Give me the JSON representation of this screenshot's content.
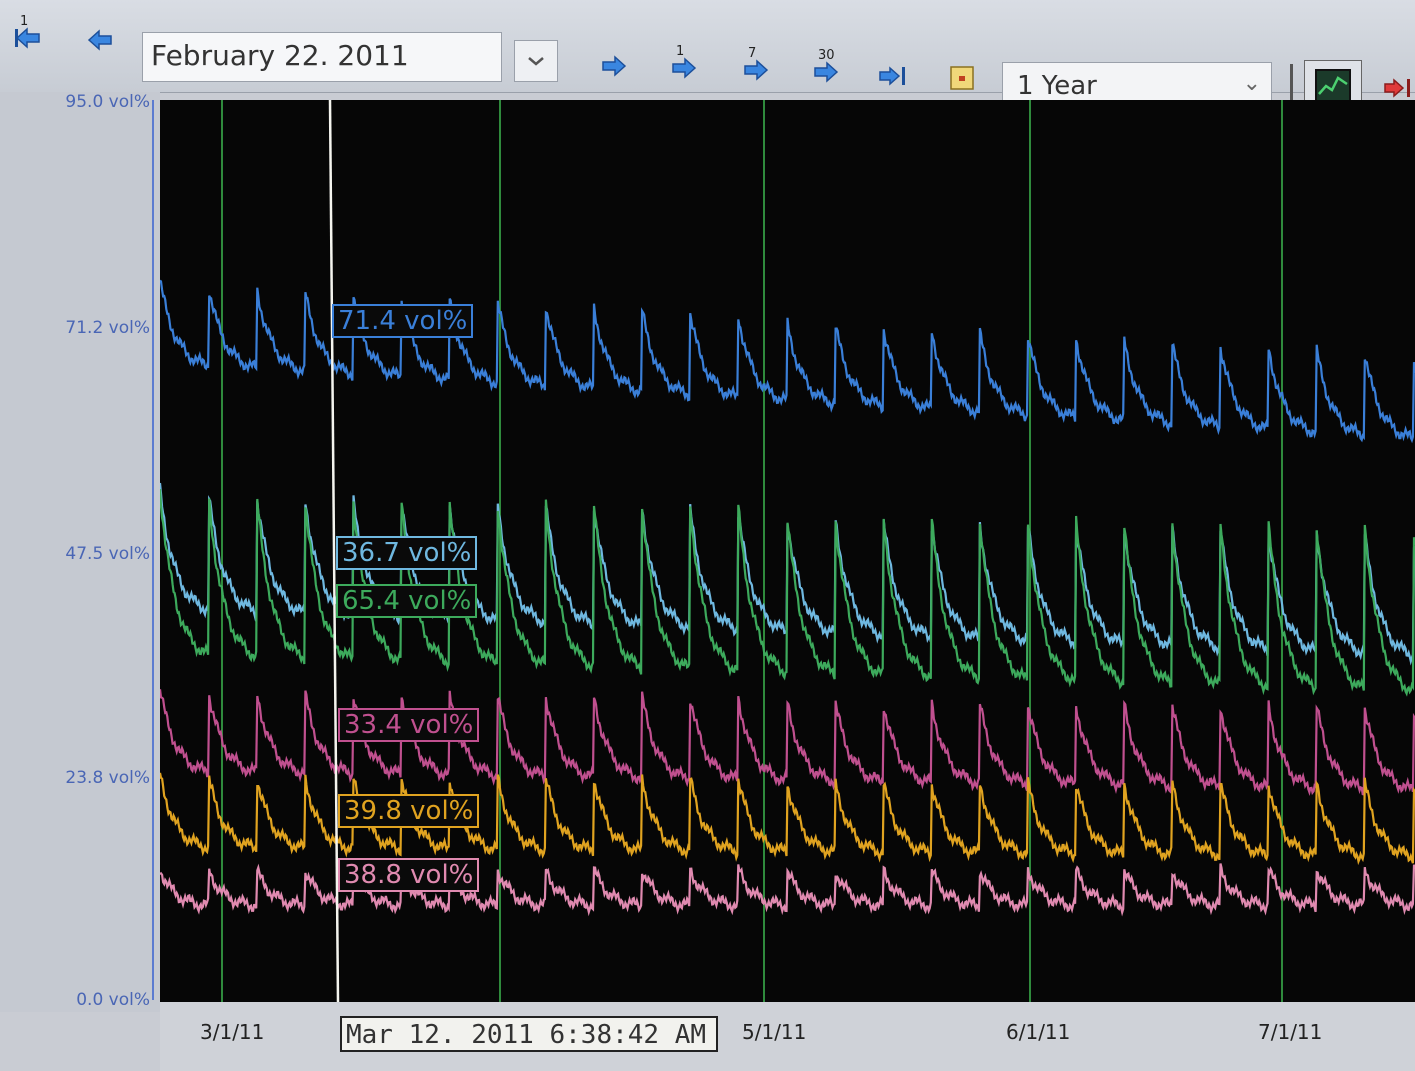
{
  "toolbar": {
    "date_value": "February 22. 2011",
    "step_labels": [
      "1",
      "1",
      "7",
      "30"
    ],
    "range_value": "1 Year"
  },
  "y_axis": {
    "ticks": [
      "95.0 vol%",
      "71.2 vol%",
      "47.5 vol%",
      "23.8 vol%",
      "0.0 vol%"
    ]
  },
  "x_axis": {
    "ticks": [
      "3/1/11",
      "5/1/11",
      "6/1/11",
      "7/1/11"
    ]
  },
  "cursor": {
    "time_label": "Mar 12. 2011 6:38:42 AM"
  },
  "series_labels": [
    {
      "text": "71.4 vol%",
      "color": "#3a7fd8"
    },
    {
      "text": "36.7 vol%",
      "color": "#6fb8e0"
    },
    {
      "text": "65.4 vol%",
      "color": "#3daa5c"
    },
    {
      "text": "33.4 vol%",
      "color": "#c0508f"
    },
    {
      "text": "39.8 vol%",
      "color": "#e0a320"
    },
    {
      "text": "38.8 vol%",
      "color": "#e08ab0"
    }
  ],
  "chart_data": {
    "type": "line",
    "ylim": [
      0,
      95
    ],
    "yticks": [
      0,
      23.8,
      47.5,
      71.2,
      95
    ],
    "x_range_days": [
      0,
      125
    ],
    "x_note_dates": [
      "2011-03-01",
      "2011-05-01",
      "2011-06-01",
      "2011-07-01"
    ],
    "cycle_days": 4.8,
    "series": [
      {
        "color": "#3a7fd8",
        "base": 67,
        "peak": 76,
        "drift": -8
      },
      {
        "color": "#6fb8e0",
        "base": 41,
        "peak": 54,
        "drift": -5
      },
      {
        "color": "#3daa5c",
        "base": 36,
        "peak": 54,
        "drift": -4
      },
      {
        "color": "#c0508f",
        "base": 24,
        "peak": 33,
        "drift": -2
      },
      {
        "color": "#e0a320",
        "base": 16,
        "peak": 24,
        "drift": -1
      },
      {
        "color": "#e08ab0",
        "base": 10,
        "peak": 14,
        "drift": 0
      }
    ]
  }
}
